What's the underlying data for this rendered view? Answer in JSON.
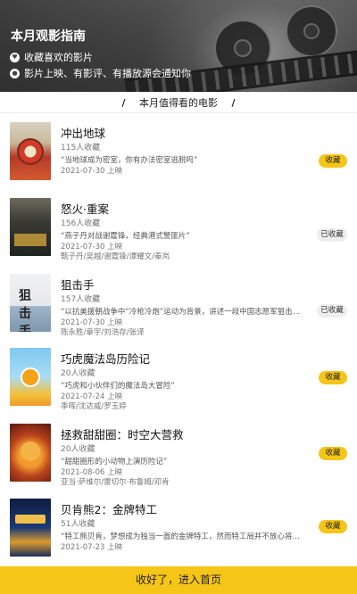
{
  "header": {
    "title": "本月观影指南",
    "line1": "收藏喜欢的影片",
    "line2": "影片上映、有影评、有播放源会通知你"
  },
  "section": {
    "title": "本月值得看的电影",
    "slash": "/"
  },
  "movies": [
    {
      "title": "冲出地球",
      "count": "115人收藏",
      "quote": "“当地球成为密室，你有办法密室逃脱吗”",
      "date": "2021-07-30 上映",
      "cast": "",
      "button": "收藏",
      "collected": false
    },
    {
      "title": "怒火·重案",
      "count": "156人收藏",
      "quote": "“燕子丹对战谢霆锋，经典港式警匪片”",
      "date": "2021-07-30 上映",
      "cast": "甄子丹/吴越/谢霆锋/谭耀文/秦岚",
      "button": "已收藏",
      "collected": true
    },
    {
      "title": "狙击手",
      "count": "157人收藏",
      "quote": "“以抗美援朝战争中“冷枪冷炮”运动为背景，讲述一段中国志愿军狙击小队与美军…",
      "date": "2021-07-30 上映",
      "cast": "陈永胜/章宇/刘浩存/张译",
      "button": "已收藏",
      "collected": true
    },
    {
      "title": "巧虎魔法岛历险记",
      "count": "20人收藏",
      "quote": "“巧虎和小伙伴们的魔法岛大冒险”",
      "date": "2021-07-24 上映",
      "cast": "季晖/沈达威/罗玉婷",
      "button": "收藏",
      "collected": false
    },
    {
      "title": "拯救甜甜圈：时空大营救",
      "count": "20人收藏",
      "quote": "“甜甜圈形的小动物上演历险记”",
      "date": "2021-08-06 上映",
      "cast": "亚当·萨维尔/雷切尔·布鲁姆/邓肯",
      "button": "收藏",
      "collected": false
    },
    {
      "title": "贝肯熊2：金牌特工",
      "count": "51人收藏",
      "quote": "“特工熊贝肯，梦想成为独当一面的金牌特工，然而特工局并不放心将任务交给一…",
      "date": "2021-07-23 上映",
      "cast": "",
      "button": "收藏",
      "collected": false
    }
  ],
  "footer": {
    "label": "收好了，进入首页"
  },
  "colors": {
    "accent": "#f5c518",
    "collected_bg": "#eeeeee"
  }
}
